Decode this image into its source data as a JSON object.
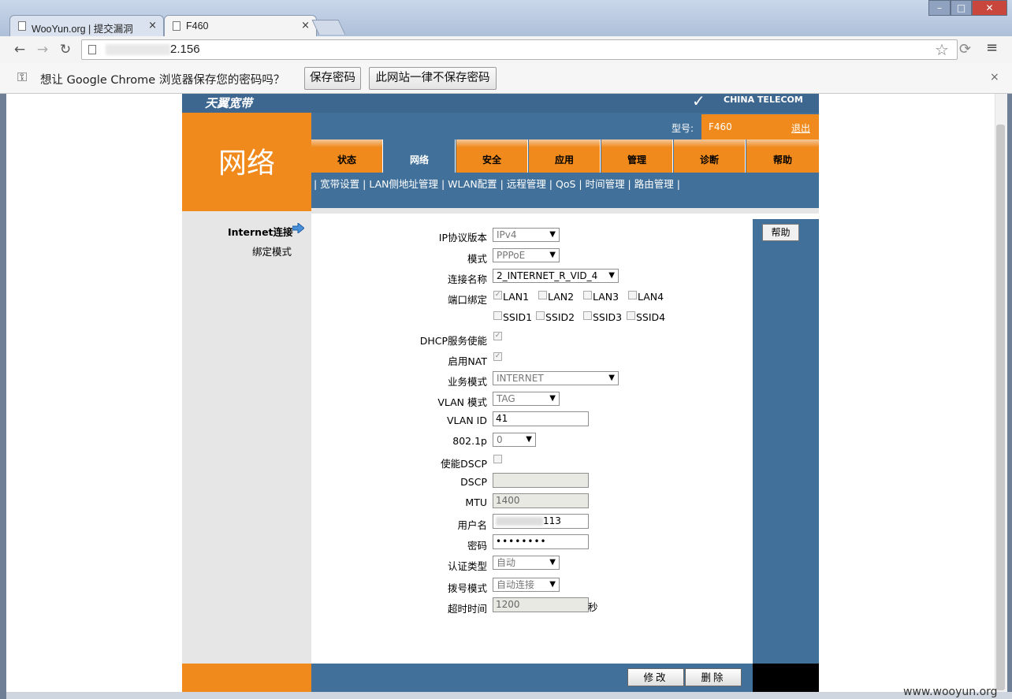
{
  "browser": {
    "tabs": [
      {
        "title": "WooYun.org | 提交漏洞",
        "close": "×"
      },
      {
        "title": "F460",
        "close": "×"
      }
    ],
    "url_visible": "2.156",
    "infobar": {
      "message": "想让 Google Chrome 浏览器保存您的密码吗？",
      "save_label": "保存密码",
      "never_label": "此网站一律不保存密码",
      "close": "×"
    }
  },
  "router": {
    "logo_text": "天翼宽带",
    "brand_text": "CHINA TELECOM",
    "section_title": "网络",
    "model_label": "型号:",
    "model_value": "F460",
    "logout": "退出",
    "nav_tabs": [
      "状态",
      "网络",
      "安全",
      "应用",
      "管理",
      "诊断",
      "帮助"
    ],
    "active_tab": "网络",
    "subnav": " | 宽带设置 | LAN侧地址管理 | WLAN配置 | 远程管理 | QoS | 时间管理 | 路由管理 | ",
    "left_menu": [
      "Internet连接",
      "绑定模式"
    ],
    "help_button": "帮助",
    "form": {
      "ip_version_label": "IP协议版本",
      "ip_version": "IPv4",
      "mode_label": "模式",
      "mode": "PPPoE",
      "conn_name_label": "连接名称",
      "conn_name": "2_INTERNET_R_VID_4",
      "port_bind_label": "端口绑定",
      "ports": [
        "LAN1",
        "LAN2",
        "LAN3",
        "LAN4"
      ],
      "ssids": [
        "SSID1",
        "SSID2",
        "SSID3",
        "SSID4"
      ],
      "dhcp_label": "DHCP服务使能",
      "nat_label": "启用NAT",
      "service_mode_label": "业务模式",
      "service_mode": "INTERNET",
      "vlan_mode_label": "VLAN 模式",
      "vlan_mode": "TAG",
      "vlan_id_label": "VLAN ID",
      "vlan_id": "41",
      "dot1p_label": "802.1p",
      "dot1p": "0",
      "dscp_enable_label": "使能DSCP",
      "dscp_label": "DSCP",
      "dscp": "",
      "mtu_label": "MTU",
      "mtu": "1400",
      "username_label": "用户名",
      "username_visible": "113",
      "password_label": "密码",
      "password": "••••••••",
      "auth_label": "认证类型",
      "auth": "自动",
      "dial_label": "拨号模式",
      "dial": "自动连接",
      "timeout_label": "超时时间",
      "timeout": "1200",
      "timeout_unit": "秒"
    },
    "modify_button": "修改",
    "delete_button": "删除"
  },
  "watermark": "www.wooyun.org"
}
